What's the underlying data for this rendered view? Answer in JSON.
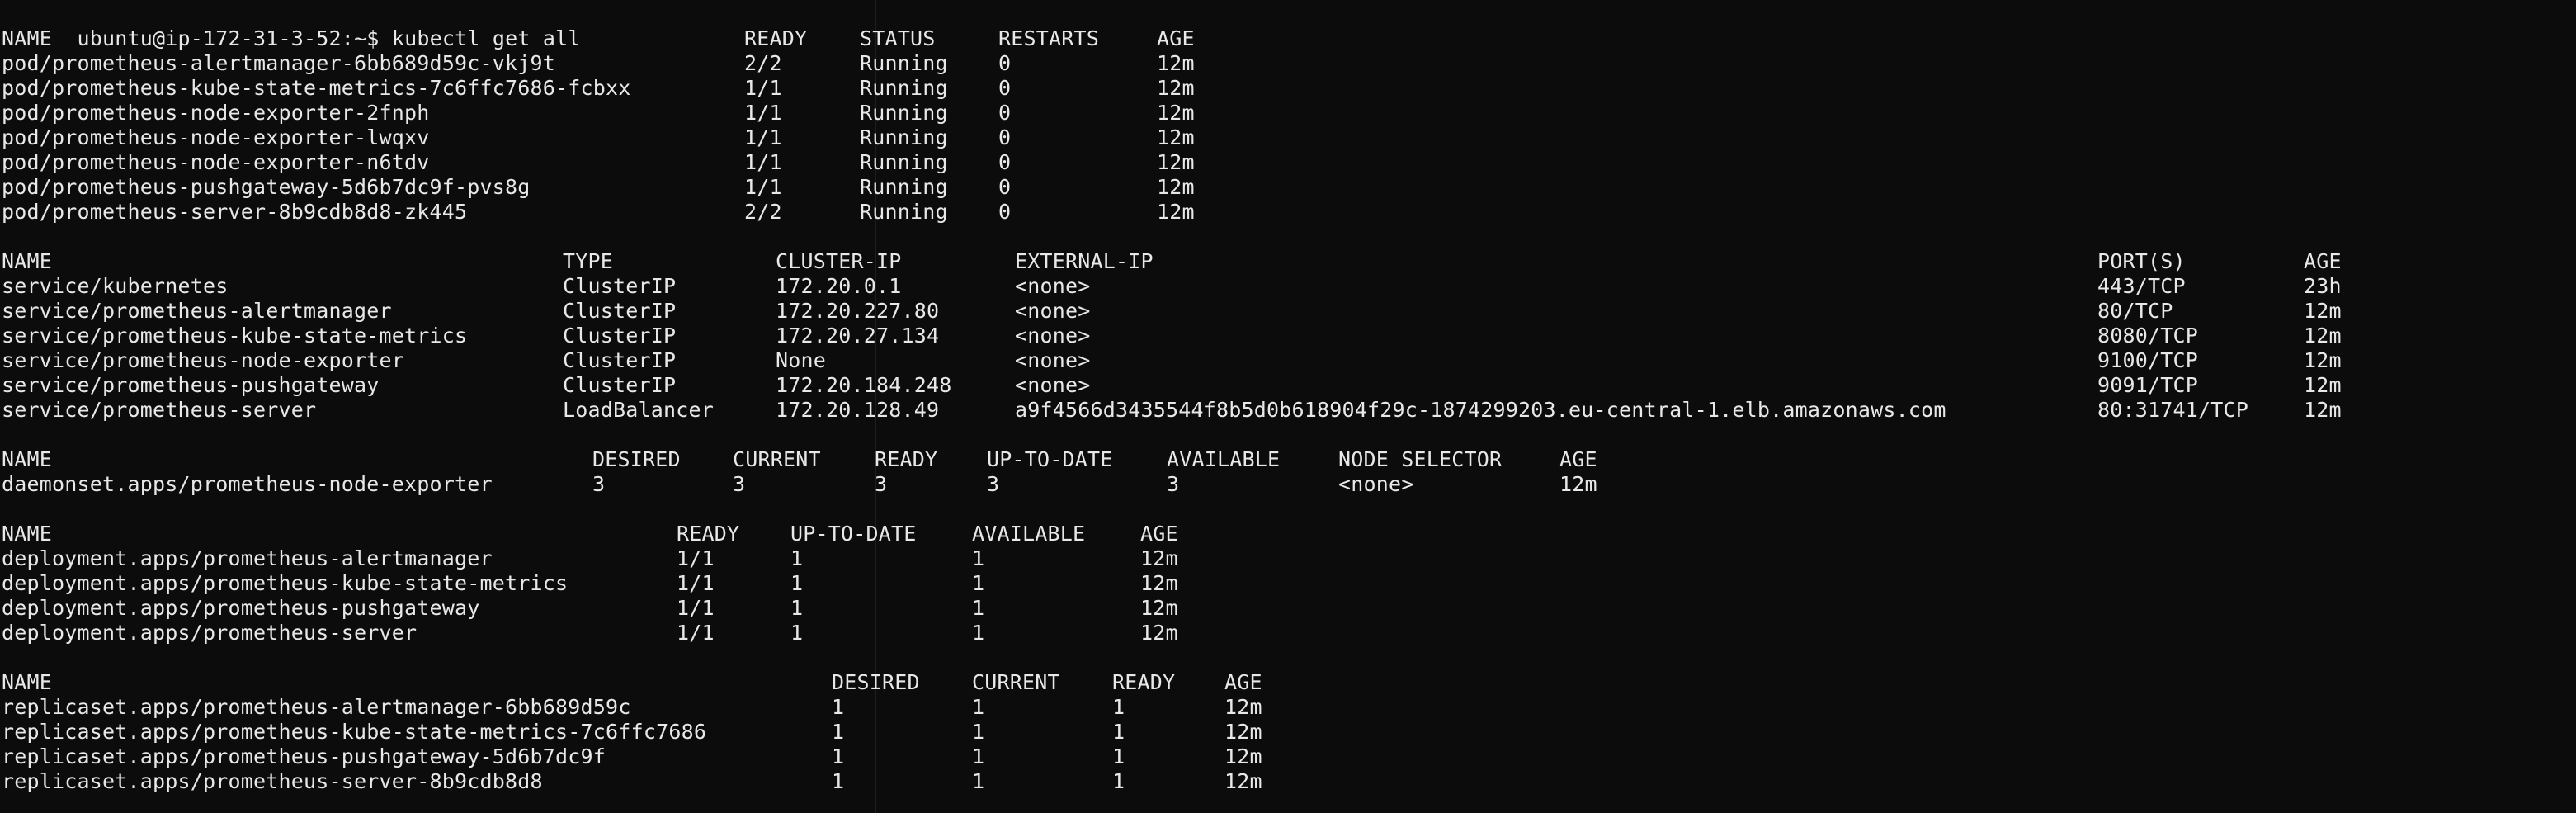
{
  "prompt": {
    "user_host": "ubuntu@ip-172-31-3-52:~$",
    "command": "kubectl get all"
  },
  "pods": {
    "headers": [
      "NAME",
      "READY",
      "STATUS",
      "RESTARTS",
      "AGE"
    ],
    "rows": [
      [
        "pod/prometheus-alertmanager-6bb689d59c-vkj9t",
        "2/2",
        "Running",
        "0",
        "12m"
      ],
      [
        "pod/prometheus-kube-state-metrics-7c6ffc7686-fcbxx",
        "1/1",
        "Running",
        "0",
        "12m"
      ],
      [
        "pod/prometheus-node-exporter-2fnph",
        "1/1",
        "Running",
        "0",
        "12m"
      ],
      [
        "pod/prometheus-node-exporter-lwqxv",
        "1/1",
        "Running",
        "0",
        "12m"
      ],
      [
        "pod/prometheus-node-exporter-n6tdv",
        "1/1",
        "Running",
        "0",
        "12m"
      ],
      [
        "pod/prometheus-pushgateway-5d6b7dc9f-pvs8g",
        "1/1",
        "Running",
        "0",
        "12m"
      ],
      [
        "pod/prometheus-server-8b9cdb8d8-zk445",
        "2/2",
        "Running",
        "0",
        "12m"
      ]
    ]
  },
  "services": {
    "headers": [
      "NAME",
      "TYPE",
      "CLUSTER-IP",
      "EXTERNAL-IP",
      "PORT(S)",
      "AGE"
    ],
    "rows": [
      [
        "service/kubernetes",
        "ClusterIP",
        "172.20.0.1",
        "<none>",
        "443/TCP",
        "23h"
      ],
      [
        "service/prometheus-alertmanager",
        "ClusterIP",
        "172.20.227.80",
        "<none>",
        "80/TCP",
        "12m"
      ],
      [
        "service/prometheus-kube-state-metrics",
        "ClusterIP",
        "172.20.27.134",
        "<none>",
        "8080/TCP",
        "12m"
      ],
      [
        "service/prometheus-node-exporter",
        "ClusterIP",
        "None",
        "<none>",
        "9100/TCP",
        "12m"
      ],
      [
        "service/prometheus-pushgateway",
        "ClusterIP",
        "172.20.184.248",
        "<none>",
        "9091/TCP",
        "12m"
      ],
      [
        "service/prometheus-server",
        "LoadBalancer",
        "172.20.128.49",
        "a9f4566d3435544f8b5d0b618904f29c-1874299203.eu-central-1.elb.amazonaws.com",
        "80:31741/TCP",
        "12m"
      ]
    ]
  },
  "daemonsets": {
    "headers": [
      "NAME",
      "DESIRED",
      "CURRENT",
      "READY",
      "UP-TO-DATE",
      "AVAILABLE",
      "NODE SELECTOR",
      "AGE"
    ],
    "rows": [
      [
        "daemonset.apps/prometheus-node-exporter",
        "3",
        "3",
        "3",
        "3",
        "3",
        "<none>",
        "12m"
      ]
    ]
  },
  "deployments": {
    "headers": [
      "NAME",
      "READY",
      "UP-TO-DATE",
      "AVAILABLE",
      "AGE"
    ],
    "rows": [
      [
        "deployment.apps/prometheus-alertmanager",
        "1/1",
        "1",
        "1",
        "12m"
      ],
      [
        "deployment.apps/prometheus-kube-state-metrics",
        "1/1",
        "1",
        "1",
        "12m"
      ],
      [
        "deployment.apps/prometheus-pushgateway",
        "1/1",
        "1",
        "1",
        "12m"
      ],
      [
        "deployment.apps/prometheus-server",
        "1/1",
        "1",
        "1",
        "12m"
      ]
    ]
  },
  "replicasets": {
    "headers": [
      "NAME",
      "DESIRED",
      "CURRENT",
      "READY",
      "AGE"
    ],
    "rows": [
      [
        "replicaset.apps/prometheus-alertmanager-6bb689d59c",
        "1",
        "1",
        "1",
        "12m"
      ],
      [
        "replicaset.apps/prometheus-kube-state-metrics-7c6ffc7686",
        "1",
        "1",
        "1",
        "12m"
      ],
      [
        "replicaset.apps/prometheus-pushgateway-5d6b7dc9f",
        "1",
        "1",
        "1",
        "12m"
      ],
      [
        "replicaset.apps/prometheus-server-8b9cdb8d8",
        "1",
        "1",
        "1",
        "12m"
      ]
    ]
  },
  "colors": {
    "background": "#0c0c0c",
    "foreground": "#e8e8e8"
  }
}
